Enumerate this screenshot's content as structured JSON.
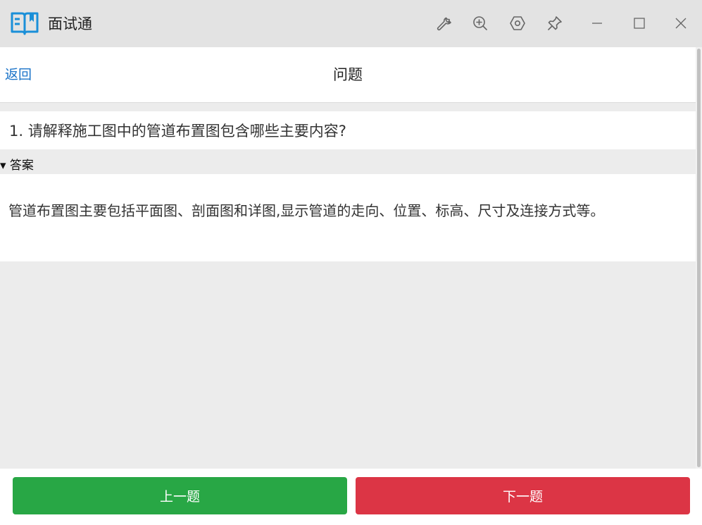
{
  "window": {
    "app_title": "面试通",
    "icons": {
      "app": "book-icon",
      "tools": "wrench-icon",
      "zoom": "zoom-in-icon",
      "settings": "hexagon-settings-icon",
      "pin": "pin-icon",
      "minimize": "minimize-icon",
      "maximize": "maximize-icon",
      "close": "close-icon"
    }
  },
  "header": {
    "back_label": "返回",
    "title": "问题"
  },
  "question": {
    "text": "1. 请解释施工图中的管道布置图包含哪些主要内容?"
  },
  "answer": {
    "summary_label": "▾ 答案",
    "text": "管道布置图主要包括平面图、剖面图和详图,显示管道的走向、位置、标高、尺寸及连接方式等。"
  },
  "footer": {
    "prev_label": "上一题",
    "next_label": "下一题"
  },
  "colors": {
    "link": "#1a73c8",
    "prev_button": "#28a745",
    "next_button": "#dc3545",
    "app_icon": "#1a8fd8"
  }
}
